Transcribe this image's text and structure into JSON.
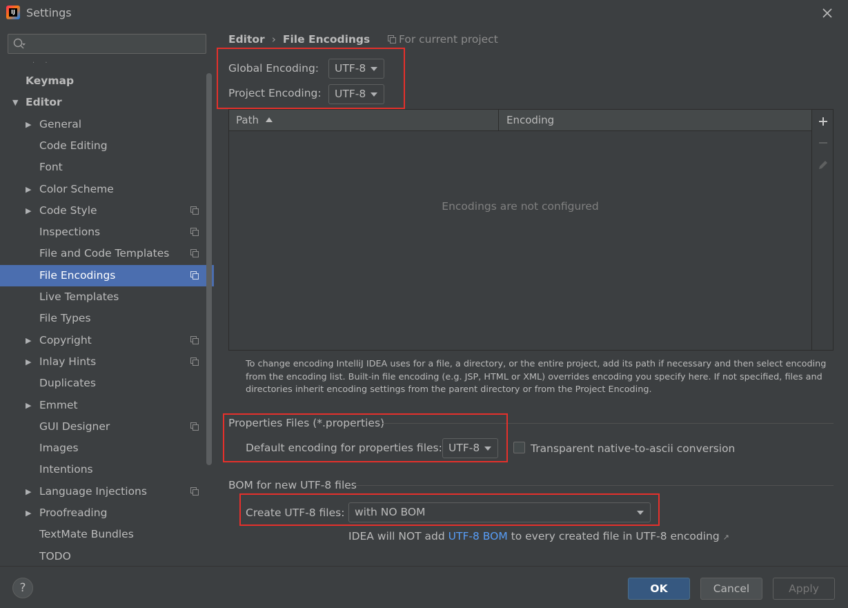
{
  "window": {
    "title": "Settings",
    "close_icon": "close-icon",
    "logo_text": "IJ"
  },
  "colors": {
    "selection": "#4b6eaf",
    "highlight_box": "#e6302b",
    "link": "#589df6",
    "ok_button": "#365880"
  },
  "search": {
    "placeholder": ""
  },
  "sidebar": {
    "partial_above": "· ·",
    "items": [
      {
        "label": "Keymap",
        "expandable": false,
        "expanded": false,
        "project_scope": false,
        "selected": false
      },
      {
        "label": "Editor",
        "expandable": true,
        "expanded": true,
        "project_scope": false,
        "selected": false
      },
      {
        "label": "General",
        "expandable": true,
        "expanded": false,
        "project_scope": false,
        "selected": false
      },
      {
        "label": "Code Editing",
        "expandable": false,
        "expanded": false,
        "project_scope": false,
        "selected": false
      },
      {
        "label": "Font",
        "expandable": false,
        "expanded": false,
        "project_scope": false,
        "selected": false
      },
      {
        "label": "Color Scheme",
        "expandable": true,
        "expanded": false,
        "project_scope": false,
        "selected": false
      },
      {
        "label": "Code Style",
        "expandable": true,
        "expanded": false,
        "project_scope": true,
        "selected": false
      },
      {
        "label": "Inspections",
        "expandable": false,
        "expanded": false,
        "project_scope": true,
        "selected": false
      },
      {
        "label": "File and Code Templates",
        "expandable": false,
        "expanded": false,
        "project_scope": true,
        "selected": false
      },
      {
        "label": "File Encodings",
        "expandable": false,
        "expanded": false,
        "project_scope": true,
        "selected": true
      },
      {
        "label": "Live Templates",
        "expandable": false,
        "expanded": false,
        "project_scope": false,
        "selected": false
      },
      {
        "label": "File Types",
        "expandable": false,
        "expanded": false,
        "project_scope": false,
        "selected": false
      },
      {
        "label": "Copyright",
        "expandable": true,
        "expanded": false,
        "project_scope": true,
        "selected": false
      },
      {
        "label": "Inlay Hints",
        "expandable": true,
        "expanded": false,
        "project_scope": true,
        "selected": false
      },
      {
        "label": "Duplicates",
        "expandable": false,
        "expanded": false,
        "project_scope": false,
        "selected": false
      },
      {
        "label": "Emmet",
        "expandable": true,
        "expanded": false,
        "project_scope": false,
        "selected": false
      },
      {
        "label": "GUI Designer",
        "expandable": false,
        "expanded": false,
        "project_scope": true,
        "selected": false
      },
      {
        "label": "Images",
        "expandable": false,
        "expanded": false,
        "project_scope": false,
        "selected": false
      },
      {
        "label": "Intentions",
        "expandable": false,
        "expanded": false,
        "project_scope": false,
        "selected": false
      },
      {
        "label": "Language Injections",
        "expandable": true,
        "expanded": false,
        "project_scope": true,
        "selected": false
      },
      {
        "label": "Proofreading",
        "expandable": true,
        "expanded": false,
        "project_scope": false,
        "selected": false
      },
      {
        "label": "TextMate Bundles",
        "expandable": false,
        "expanded": false,
        "project_scope": false,
        "selected": false
      },
      {
        "label": "TODO",
        "expandable": false,
        "expanded": false,
        "project_scope": false,
        "selected": false
      }
    ]
  },
  "breadcrumb": {
    "parent": "Editor",
    "separator": "›",
    "current": "File Encodings",
    "scope": "For current project"
  },
  "encodings": {
    "global_label": "Global Encoding:",
    "global_value": "UTF-8",
    "project_label": "Project Encoding:",
    "project_value": "UTF-8"
  },
  "table": {
    "columns": [
      "Path",
      "Encoding"
    ],
    "sort_column": "Path",
    "sort_direction": "ascending",
    "empty_text": "Encodings are not configured",
    "tools": [
      "plus-icon",
      "minus-icon",
      "edit-icon"
    ]
  },
  "help_text": "To change encoding IntelliJ IDEA uses for a file, a directory, or the entire project, add its path if necessary and then select encoding from the encoding list. Built-in file encoding (e.g. JSP, HTML or XML) overrides encoding you specify here. If not specified, files and directories inherit encoding settings from the parent directory or from the Project Encoding.",
  "properties": {
    "section_title": "Properties Files (*.properties)",
    "default_label": "Default encoding for properties files:",
    "default_value": "UTF-8",
    "native_ascii_label": "Transparent native-to-ascii conversion",
    "native_ascii_checked": false
  },
  "bom": {
    "section_title": "BOM for new UTF-8 files",
    "create_label": "Create UTF-8 files:",
    "create_value": "with NO BOM",
    "note_prefix": "IDEA will NOT add ",
    "note_link": "UTF-8 BOM",
    "note_suffix": " to every created file in UTF-8 encoding",
    "note_arrow": "↗"
  },
  "footer": {
    "help": "?",
    "ok": "OK",
    "cancel": "Cancel",
    "apply": "Apply",
    "apply_enabled": false
  }
}
